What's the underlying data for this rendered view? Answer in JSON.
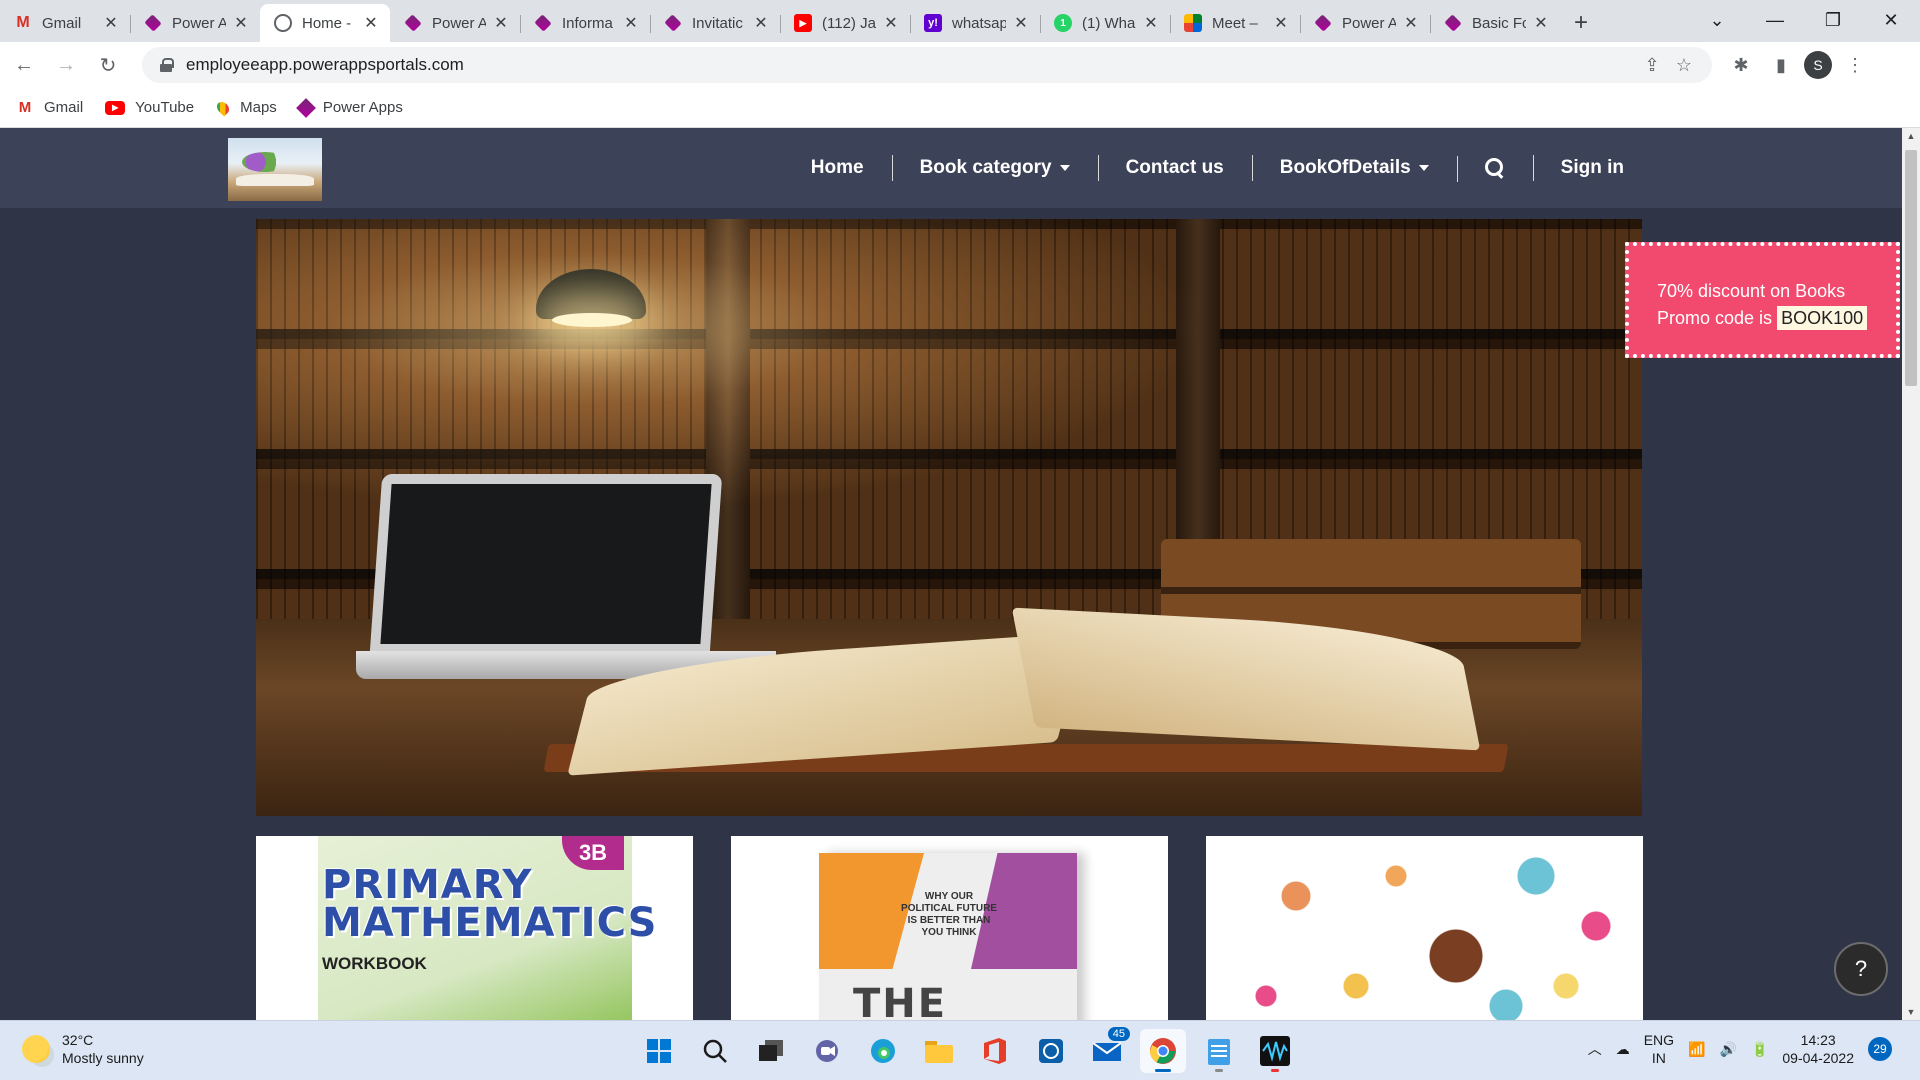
{
  "browser": {
    "tabs": [
      {
        "title": "Gmail",
        "icon": "gmail-icon"
      },
      {
        "title": "Power A",
        "icon": "power-apps-icon"
      },
      {
        "title": "Home -",
        "icon": "globe-icon"
      },
      {
        "title": "Power A",
        "icon": "power-apps-icon"
      },
      {
        "title": "Informa",
        "icon": "power-apps-icon"
      },
      {
        "title": "Invitatic",
        "icon": "power-apps-icon"
      },
      {
        "title": "(112) Ja",
        "icon": "youtube-icon"
      },
      {
        "title": "whatsap",
        "icon": "yahoo-icon"
      },
      {
        "title": "(1) Wha",
        "icon": "whatsapp-icon"
      },
      {
        "title": "Meet –",
        "icon": "meet-icon"
      },
      {
        "title": "Power A",
        "icon": "power-apps-icon"
      },
      {
        "title": "Basic Fc",
        "icon": "power-apps-icon"
      }
    ],
    "url": "employeeapp.powerappsportals.com",
    "profile_initial": "S",
    "bookmarks": [
      {
        "label": "Gmail",
        "icon": "gmail-icon"
      },
      {
        "label": "YouTube",
        "icon": "youtube-icon"
      },
      {
        "label": "Maps",
        "icon": "maps-icon"
      },
      {
        "label": "Power Apps",
        "icon": "power-apps-icon"
      }
    ]
  },
  "site": {
    "nav": {
      "home": "Home",
      "book_category": "Book category",
      "contact": "Contact us",
      "book_details": "BookOfDetails",
      "sign_in": "Sign in"
    },
    "promo": {
      "line1": "70% discount on Books",
      "line2_prefix": "Promo code is",
      "code": "BOOK100"
    },
    "cards": {
      "math_badge": "3B",
      "math_title": "PRIMARY MATHEMATICS",
      "math_sub": "WORKBOOK",
      "path_tag": "WHY OUR POLITICAL FUTURE IS BETTER THAN YOU THINK",
      "path_title": "THE PATH"
    }
  },
  "taskbar": {
    "temperature": "32°C",
    "weather": "Mostly sunny",
    "mail_badge": "45",
    "lang_line1": "ENG",
    "lang_line2": "IN",
    "time": "14:23",
    "date": "09-04-2022",
    "notifications": "29"
  },
  "colors": {
    "page_bg": "#2f3447",
    "navbar_bg": "#3c4257",
    "promo_bg": "#f24a6e"
  }
}
